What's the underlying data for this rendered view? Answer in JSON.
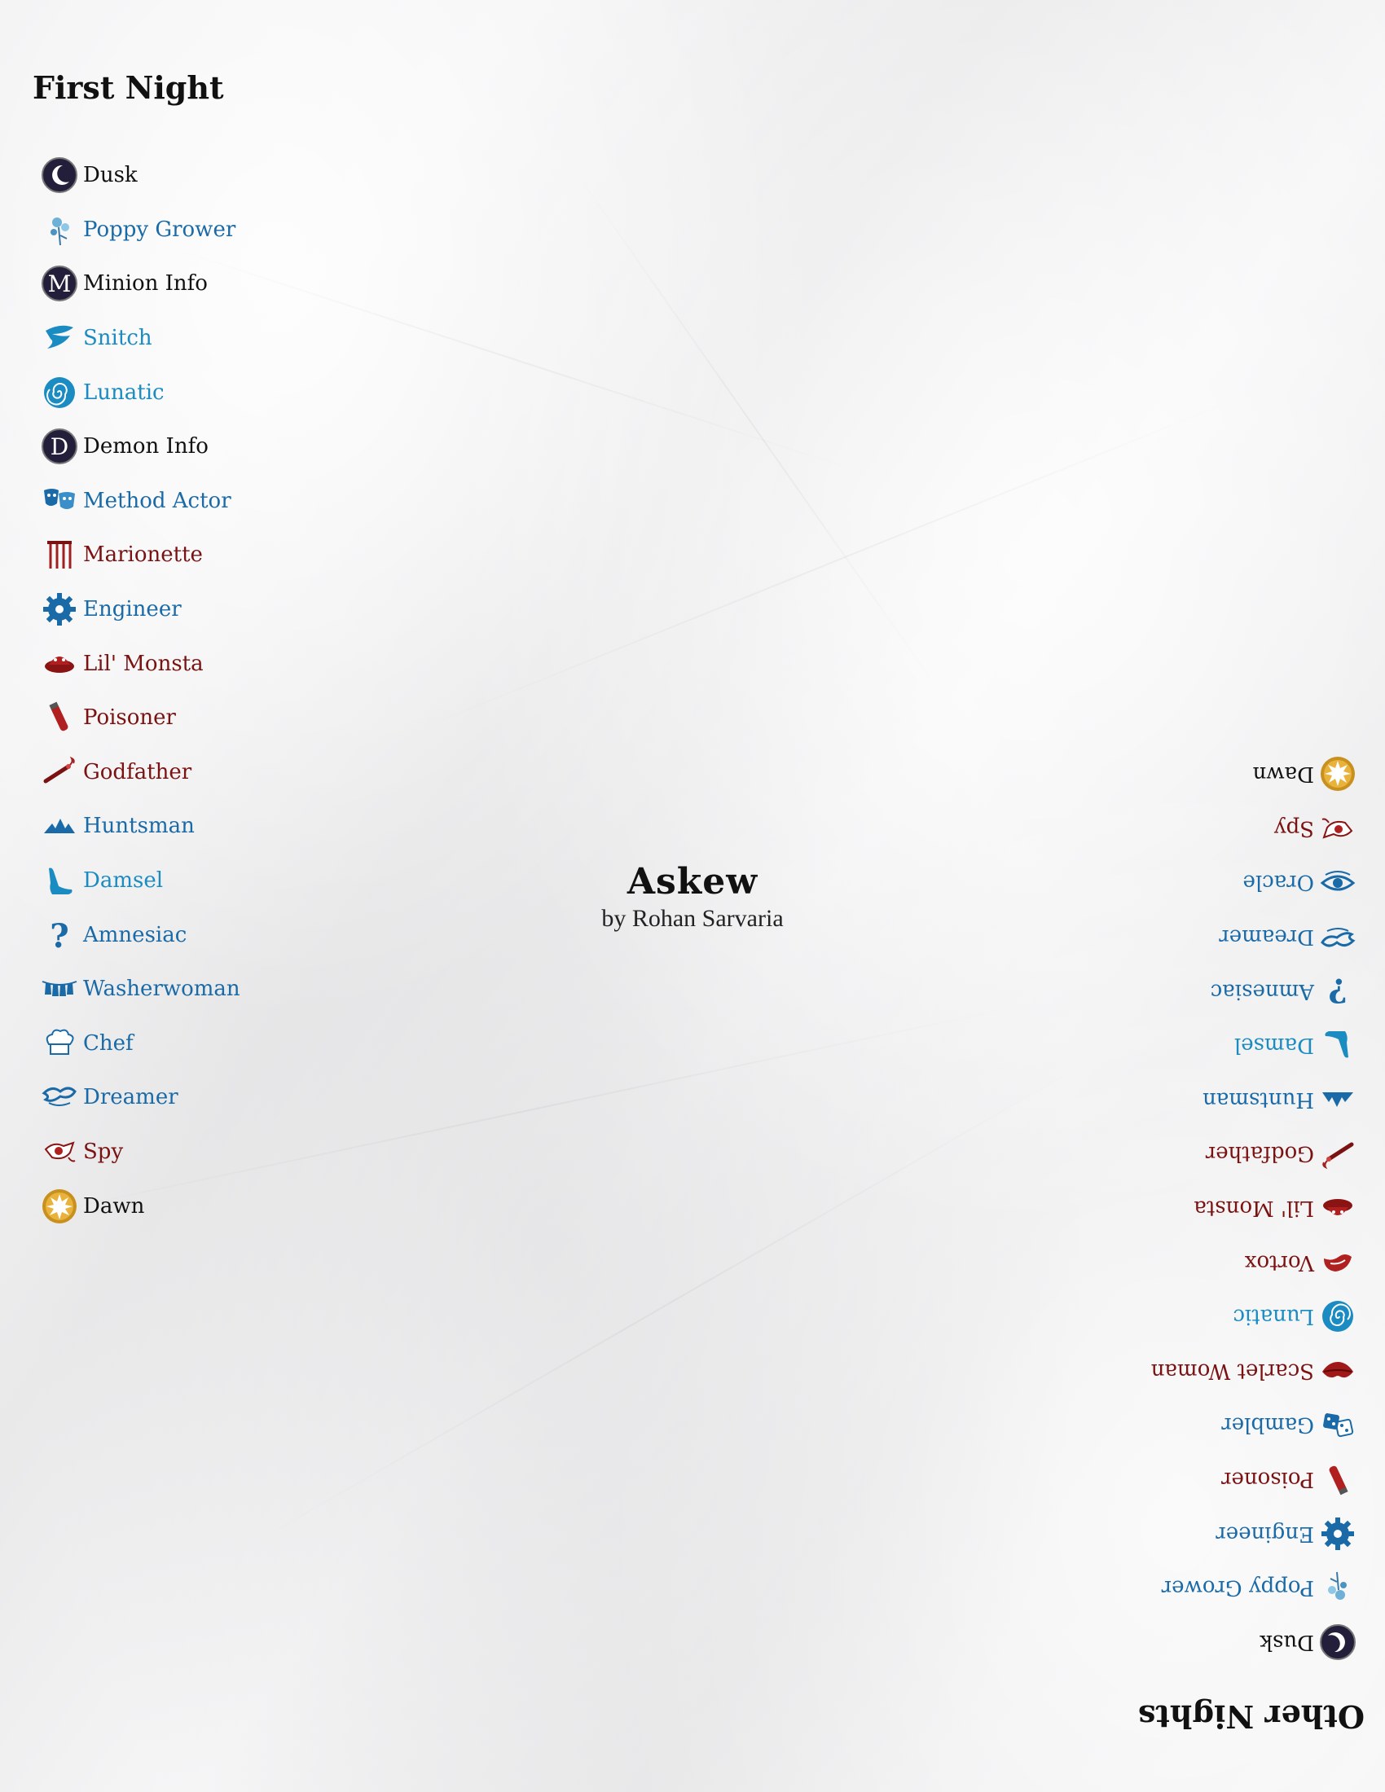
{
  "title": "Askew",
  "author": "by Rohan Sarvaria",
  "first_night": {
    "heading": "First Night",
    "items": [
      {
        "label": "Dusk",
        "team": "meta",
        "icon": "moon-icon"
      },
      {
        "label": "Poppy Grower",
        "team": "town",
        "icon": "poppy-icon"
      },
      {
        "label": "Minion Info",
        "team": "meta",
        "icon": "minion-info-icon"
      },
      {
        "label": "Snitch",
        "team": "out",
        "icon": "snitch-icon"
      },
      {
        "label": "Lunatic",
        "team": "out",
        "icon": "spiral-icon"
      },
      {
        "label": "Demon Info",
        "team": "meta",
        "icon": "demon-info-icon"
      },
      {
        "label": "Method Actor",
        "team": "town",
        "icon": "theater-masks-icon"
      },
      {
        "label": "Marionette",
        "team": "evil",
        "icon": "marionette-icon"
      },
      {
        "label": "Engineer",
        "team": "town",
        "icon": "gear-icon"
      },
      {
        "label": "Lil' Monsta",
        "team": "evil",
        "icon": "lil-monsta-icon"
      },
      {
        "label": "Poisoner",
        "team": "evil",
        "icon": "poison-vial-icon"
      },
      {
        "label": "Godfather",
        "team": "evil",
        "icon": "cigar-icon"
      },
      {
        "label": "Huntsman",
        "team": "town",
        "icon": "huntsman-icon"
      },
      {
        "label": "Damsel",
        "team": "out",
        "icon": "slipper-icon"
      },
      {
        "label": "Amnesiac",
        "team": "town",
        "icon": "question-mark-icon"
      },
      {
        "label": "Washerwoman",
        "team": "town",
        "icon": "washerwoman-icon"
      },
      {
        "label": "Chef",
        "team": "town",
        "icon": "chef-hat-icon"
      },
      {
        "label": "Dreamer",
        "team": "town",
        "icon": "dreamer-icon"
      },
      {
        "label": "Spy",
        "team": "evil",
        "icon": "spy-icon"
      },
      {
        "label": "Dawn",
        "team": "meta",
        "icon": "sun-icon"
      }
    ]
  },
  "other_nights": {
    "heading": "Other Nights",
    "items": [
      {
        "label": "Dusk",
        "team": "meta",
        "icon": "moon-icon"
      },
      {
        "label": "Poppy Grower",
        "team": "town",
        "icon": "poppy-icon"
      },
      {
        "label": "Engineer",
        "team": "town",
        "icon": "gear-icon"
      },
      {
        "label": "Poisoner",
        "team": "evil",
        "icon": "poison-vial-icon"
      },
      {
        "label": "Gambler",
        "team": "town",
        "icon": "dice-icon"
      },
      {
        "label": "Scarlet Woman",
        "team": "evil",
        "icon": "lips-icon"
      },
      {
        "label": "Lunatic",
        "team": "out",
        "icon": "spiral-icon"
      },
      {
        "label": "Vortox",
        "team": "evil",
        "icon": "vortox-icon"
      },
      {
        "label": "Lil' Monsta",
        "team": "evil",
        "icon": "lil-monsta-icon"
      },
      {
        "label": "Godfather",
        "team": "evil",
        "icon": "cigar-icon"
      },
      {
        "label": "Huntsman",
        "team": "town",
        "icon": "huntsman-icon"
      },
      {
        "label": "Damsel",
        "team": "out",
        "icon": "slipper-icon"
      },
      {
        "label": "Amnesiac",
        "team": "town",
        "icon": "question-mark-icon"
      },
      {
        "label": "Dreamer",
        "team": "town",
        "icon": "dreamer-icon"
      },
      {
        "label": "Oracle",
        "team": "town",
        "icon": "oracle-eye-icon"
      },
      {
        "label": "Spy",
        "team": "evil",
        "icon": "spy-icon"
      },
      {
        "label": "Dawn",
        "team": "meta",
        "icon": "sun-icon"
      }
    ]
  },
  "colors": {
    "meta": "#111111",
    "town": "#1a6aa8",
    "out": "#1a8cc2",
    "evil": "#7a1212",
    "dawn_gold": "#c8901e",
    "night_navy": "#231f3a"
  }
}
